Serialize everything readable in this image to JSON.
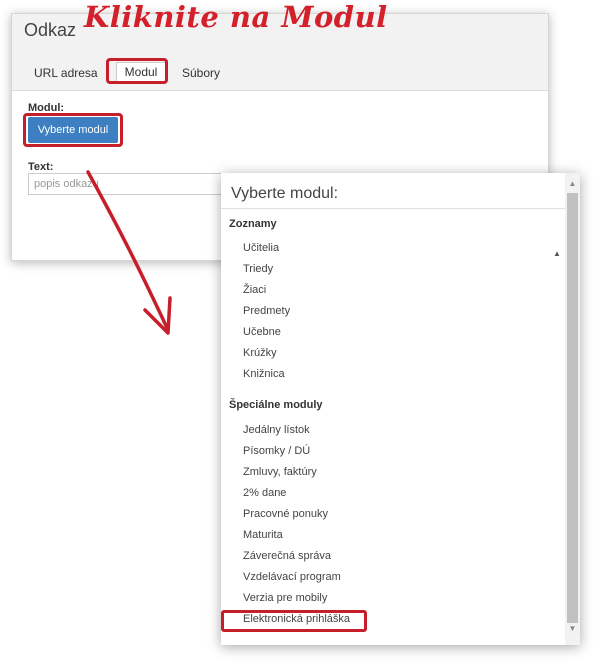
{
  "dialog1": {
    "title": "Odkaz",
    "annotation": "Kliknite na Modul",
    "tabs": [
      "URL adresa",
      "Modul",
      "Súbory"
    ],
    "modul_label": "Modul:",
    "select_module_button": "Vyberte modul",
    "text_label": "Text:",
    "text_placeholder": "popis odkazu"
  },
  "dialog2": {
    "title": "Vyberte modul:",
    "groups": [
      {
        "name": "Zoznamy",
        "items": [
          "Učitelia",
          "Triedy",
          "Žiaci",
          "Predmety",
          "Učebne",
          "Krúžky",
          "Knižnica"
        ]
      },
      {
        "name": "Špeciálne moduly",
        "items": [
          "Jedálny lístok",
          "Písomky / DÚ",
          "Zmluvy, faktúry",
          "2% dane",
          "Pracovné ponuky",
          "Maturita",
          "Záverečná správa",
          "Vzdelávací program",
          "Verzia pre mobily",
          "Elektronická prihláška"
        ]
      }
    ]
  },
  "colors": {
    "accent_red": "#c71e2b",
    "button_blue": "#3d7fc1"
  },
  "icons": {
    "scroll_up": "▲",
    "scroll_down": "▼"
  }
}
